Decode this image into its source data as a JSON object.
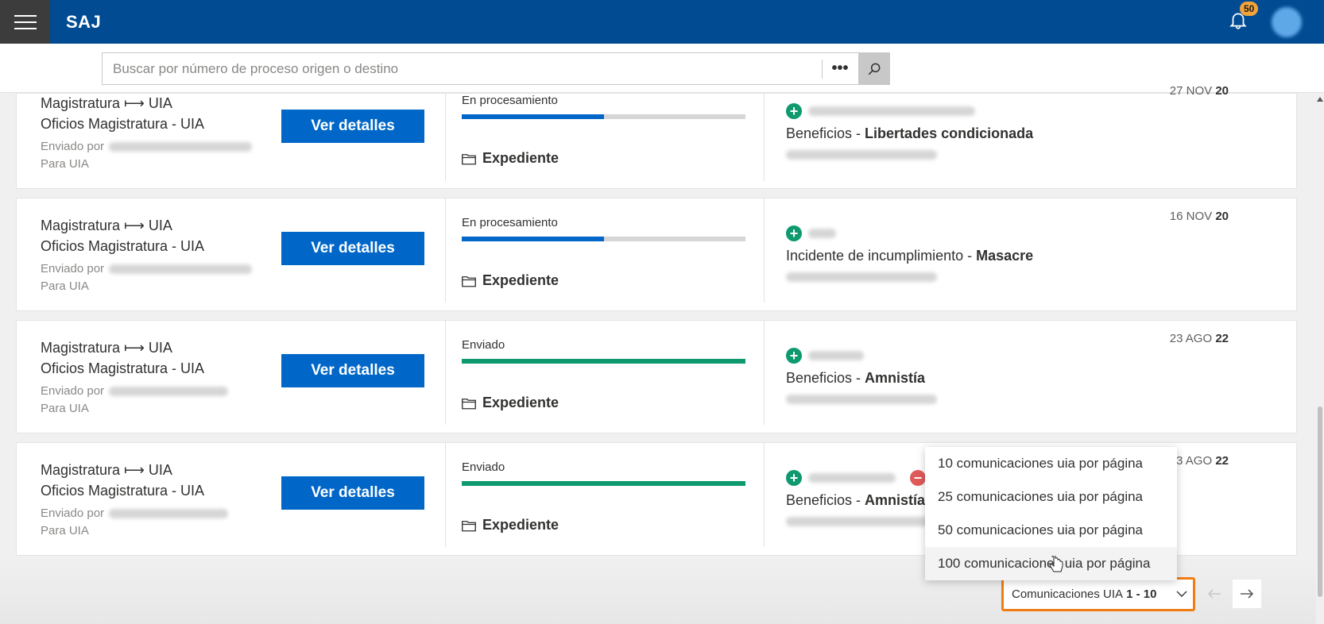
{
  "app": {
    "title": "SAJ",
    "notification_count": "50"
  },
  "search": {
    "placeholder": "Buscar por número de proceso origen o destino",
    "more_label": "•••"
  },
  "cards": [
    {
      "route": "Magistratura ⟼ UIA",
      "office": "Oficios Magistratura - UIA",
      "sent_by_label": "Enviado por",
      "to_label": "Para UIA",
      "button": "Ver detalles",
      "status": "En procesamiento",
      "progress": 0.5,
      "progress_color": "#0067c8",
      "folder_label": "Expediente",
      "matter_type": "Beneficios - ",
      "matter_name": "Libertades condicionada",
      "date_day_month": "27 NOV ",
      "date_year": "20"
    },
    {
      "route": "Magistratura ⟼ UIA",
      "office": "Oficios Magistratura - UIA",
      "sent_by_label": "Enviado por",
      "to_label": "Para UIA",
      "button": "Ver detalles",
      "status": "En procesamiento",
      "progress": 0.5,
      "progress_color": "#0067c8",
      "folder_label": "Expediente",
      "matter_type": "Incidente de incumplimiento - ",
      "matter_name": "Masacre",
      "date_day_month": "16 NOV ",
      "date_year": "20"
    },
    {
      "route": "Magistratura ⟼ UIA",
      "office": "Oficios Magistratura - UIA",
      "sent_by_label": "Enviado por",
      "to_label": "Para UIA",
      "button": "Ver detalles",
      "status": "Enviado",
      "progress": 1.0,
      "progress_color": "#0e9a6e",
      "folder_label": "Expediente",
      "matter_type": "Beneficios - ",
      "matter_name": "Amnistía",
      "date_day_month": "23 AGO ",
      "date_year": "22"
    },
    {
      "route": "Magistratura ⟼ UIA",
      "office": "Oficios Magistratura - UIA",
      "sent_by_label": "Enviado por",
      "to_label": "Para UIA",
      "button": "Ver detalles",
      "status": "Enviado",
      "progress": 1.0,
      "progress_color": "#0e9a6e",
      "folder_label": "Expediente",
      "matter_type": "Beneficios - ",
      "matter_name": "Amnistía",
      "date_day_month": "3 AGO ",
      "date_year": "22"
    }
  ],
  "page_size_menu": {
    "options": [
      "10 comunicaciones uia por página",
      "25 comunicaciones uia por página",
      "50 comunicaciones uia por página",
      "100 comunicaciones uia por página"
    ],
    "hovered_index": 3
  },
  "pager": {
    "label": "Comunicaciones UIA",
    "range": "1 - 10"
  },
  "colors": {
    "header": "#004b92",
    "button": "#0067c8",
    "progress_processing": "#0067c8",
    "progress_sent": "#0e9a6e",
    "badge": "#f2a43a",
    "highlight_border": "#f07d14"
  },
  "icons": [
    "hamburger-icon",
    "bell-icon",
    "search-icon",
    "folder-icon",
    "plus-circle-icon",
    "minus-circle-icon",
    "chevron-down-icon",
    "arrow-left-icon",
    "arrow-right-icon",
    "pointer-cursor-icon"
  ]
}
